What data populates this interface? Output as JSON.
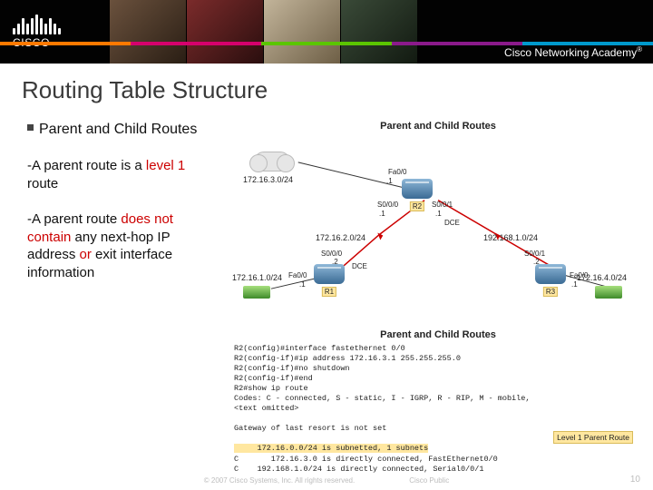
{
  "header": {
    "brand_word": "CISCO",
    "academy_text": "Cisco Networking Academy"
  },
  "title": "Routing Table Structure",
  "left": {
    "bullet": "Parent and Child Routes",
    "p1_a": "-A parent route is a ",
    "p1_b": "level 1",
    "p1_c": " route",
    "p2_a": "-A parent route ",
    "p2_b": "does not contain",
    "p2_c": " any next-hop IP address ",
    "p2_d": "or",
    "p2_e": " exit interface information"
  },
  "diagram": {
    "title": "Parent and Child Routes",
    "nets": {
      "n1": "172.16.3.0/24",
      "n2": "172.16.2.0/24",
      "n3": "192.168.1.0/24",
      "n4": "172.16.1.0/24",
      "n5": "172.16.4.0/24"
    },
    "if": {
      "fa00": "Fa0/0",
      "s000": "S0/0/0",
      "s001": "S0/0/1",
      "dce": "DCE",
      "d1": ".1",
      "d2": ".2"
    },
    "routers": {
      "r1": "R1",
      "r2": "R2",
      "r3": "R3"
    }
  },
  "cli": {
    "title": "Parent and Child Routes",
    "l1": "R2(config)#interface fastethernet 0/0",
    "l2": "R2(config-if)#ip address 172.16.3.1 255.255.255.0",
    "l3": "R2(config-if)#no shutdown",
    "l4": "R2(config-if)#end",
    "l5": "R2#show ip route",
    "l6": "Codes: C - connected, S - static, I - IGRP, R - RIP, M - mobile,",
    "l7": "<text omitted>",
    "l8": "Gateway of last resort is not set",
    "l9": "     172.16.0.0/24 is subnetted, 1 subnets",
    "l10": "C       172.16.3.0 is directly connected, FastEthernet0/0",
    "l11": "C    192.168.1.0/24 is directly connected, Serial0/0/1",
    "callout": "Level 1 Parent Route"
  },
  "footer": {
    "copyright": "© 2007 Cisco Systems, Inc. All rights reserved.",
    "label": "Cisco Public",
    "page": "10"
  }
}
